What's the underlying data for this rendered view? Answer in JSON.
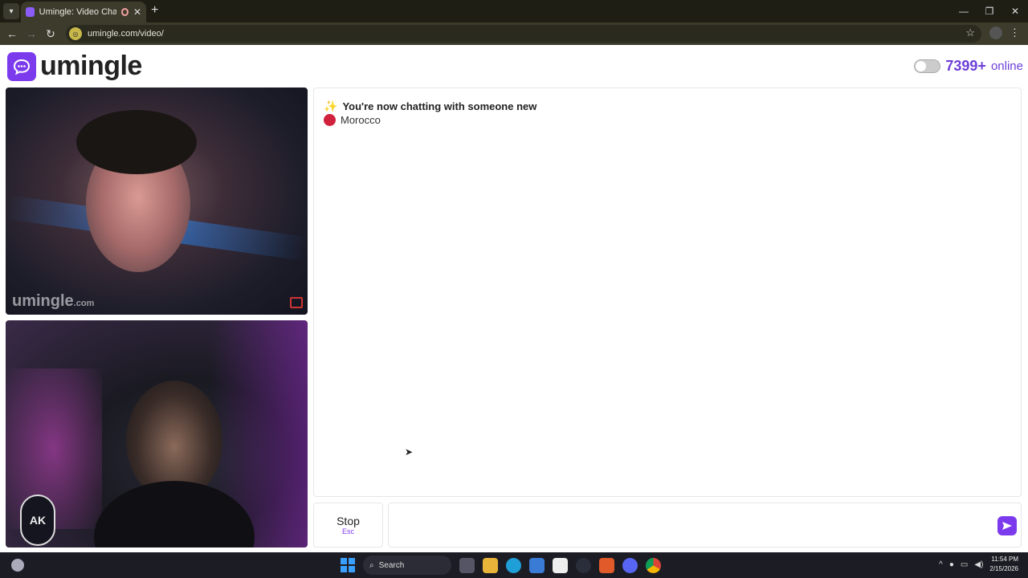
{
  "browser": {
    "tab_title": "Umingle: Video Chat with S",
    "new_tab_symbol": "+",
    "close_symbol": "✕",
    "url": "umingle.com/video/"
  },
  "header": {
    "logo_text": "umingle",
    "online_count": "7399+",
    "online_label": "online"
  },
  "videos": {
    "watermark_main": "umingle",
    "watermark_suffix": ".com",
    "badge_text": "AK"
  },
  "chat": {
    "sparkle": "✨",
    "status_message": "You're now chatting with someone new",
    "country": "Morocco"
  },
  "controls": {
    "stop_label": "Stop",
    "stop_key": "Esc",
    "message_placeholder": ""
  },
  "taskbar": {
    "search_label": "Search",
    "time": "11:54 PM",
    "date": "2/15/2026"
  },
  "colors": {
    "brand": "#7c3aed",
    "online_text": "#6d3fd8",
    "flag": "#d0213d"
  }
}
